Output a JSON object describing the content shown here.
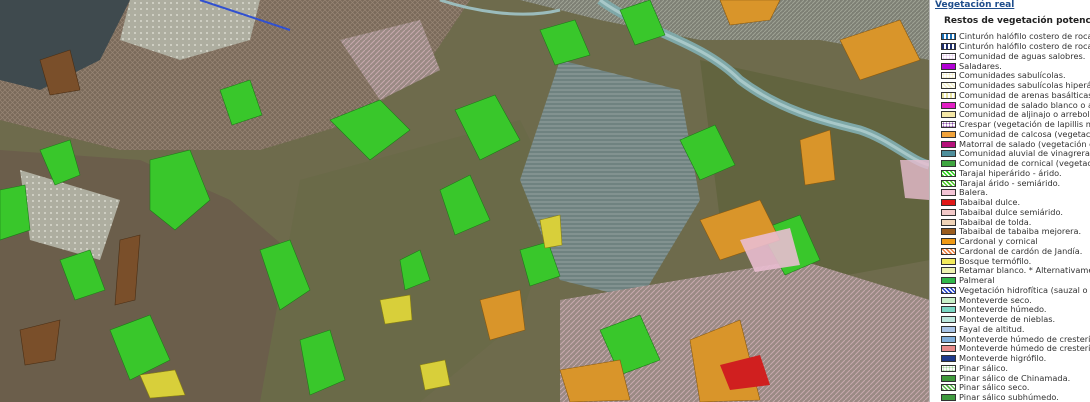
{
  "legend": {
    "title": "Vegetación real",
    "section_title": "Restos de vegetación potencial",
    "items": [
      {
        "label": "Cinturón halófilo costero de roca ár",
        "color": "#1a6fb5",
        "pattern": "vstripe"
      },
      {
        "label": "Cinturón halófilo costero de roca se",
        "color": "#1e2f6e",
        "pattern": "vstripe"
      },
      {
        "label": "Comunidad de aguas salobres.",
        "color": "#e6c8ee",
        "pattern": "dots"
      },
      {
        "label": "Saladares.",
        "color": "#b200d6",
        "pattern": "solid"
      },
      {
        "label": "Comunidades sabulícolas.",
        "color": "#f3eec0",
        "pattern": "dots"
      },
      {
        "label": "Comunidades sabulícolas hiperárida",
        "color": "#f2f0cc",
        "pattern": "diag"
      },
      {
        "label": "Comunidad de arenas basálticas ed",
        "color": "#e8e4a0",
        "pattern": "vstripe"
      },
      {
        "label": "Comunidad de salado blanco o ahul",
        "color": "#e21fc4",
        "pattern": "solid"
      },
      {
        "label": "Comunidad de aljinajo o arrebol y t",
        "color": "#f5e8a6",
        "pattern": "solid"
      },
      {
        "label": "Crespar (vegetación de lapillis mes",
        "color": "#8a4aa6",
        "pattern": "dots"
      },
      {
        "label": "Comunidad de calcosa (vegetación",
        "color": "#f0a23a",
        "pattern": "solid"
      },
      {
        "label": "Matorral de salado (vegetación de a",
        "color": "#b5107a",
        "pattern": "solid"
      },
      {
        "label": "Comunidad aluvial de vinagrera (ve",
        "color": "#4f8f9c",
        "pattern": "solid"
      },
      {
        "label": "Comunidad de cornical (vegetación",
        "color": "#3fa640",
        "pattern": "solid"
      },
      {
        "label": "Tarajal hiperárido - árido.",
        "color": "#2fd21f",
        "pattern": "diag"
      },
      {
        "label": "Tarajal árido - semiárido.",
        "color": "#4ecb2a",
        "pattern": "diag"
      },
      {
        "label": "Balera.",
        "color": "#f3c4d6",
        "pattern": "solid"
      },
      {
        "label": "Tabaibal dulce.",
        "color": "#e01818",
        "pattern": "solid"
      },
      {
        "label": "Tabaibal dulce semiárido.",
        "color": "#f2c9c9",
        "pattern": "solid"
      },
      {
        "label": "Tabaibal de tolda.",
        "color": "#f0d4b8",
        "pattern": "solid"
      },
      {
        "label": "Tabaibal de tabaiba mejorera.",
        "color": "#9a5c1e",
        "pattern": "solid"
      },
      {
        "label": "Cardonal y cornical",
        "color": "#f09a16",
        "pattern": "solid"
      },
      {
        "label": "Cardonal de cardón de Jandía.",
        "color": "#f08040",
        "pattern": "diag"
      },
      {
        "label": "Bosque termófilo.",
        "color": "#f3ea5c",
        "pattern": "solid"
      },
      {
        "label": "Retamar blanco. * Alternativamente",
        "color": "#eef2b0",
        "pattern": "solid"
      },
      {
        "label": "Palmeral",
        "color": "#2fb84a",
        "pattern": "solid"
      },
      {
        "label": "Vegetación hidrofítica (sauzal o jun",
        "color": "#2040c8",
        "pattern": "diag"
      },
      {
        "label": "Monteverde seco.",
        "color": "#c8f0c8",
        "pattern": "solid"
      },
      {
        "label": "Monteverde húmedo.",
        "color": "#7ad8c4",
        "pattern": "solid"
      },
      {
        "label": "Monteverde de nieblas.",
        "color": "#bde8de",
        "pattern": "solid"
      },
      {
        "label": "Fayal de altitud.",
        "color": "#a9c4e8",
        "pattern": "solid"
      },
      {
        "label": "Monteverde húmedo de crestería co",
        "color": "#7faedc",
        "pattern": "solid"
      },
      {
        "label": "Monteverde húmedo de crestería co",
        "color": "#e88a8a",
        "pattern": "solid"
      },
      {
        "label": "Monteverde higrófilo.",
        "color": "#1e3a8c",
        "pattern": "solid"
      },
      {
        "label": "Pinar sálico.",
        "color": "#a6d8a0",
        "pattern": "dots"
      },
      {
        "label": "Pinar sálico de Chinamada.",
        "color": "#3e9a3a",
        "pattern": "solid"
      },
      {
        "label": "Pinar sálico seco.",
        "color": "#5ab84a",
        "pattern": "diag"
      },
      {
        "label": "Pinar sálico subhúmedo.",
        "color": "#3f9a3f",
        "pattern": "solid"
      }
    ]
  }
}
